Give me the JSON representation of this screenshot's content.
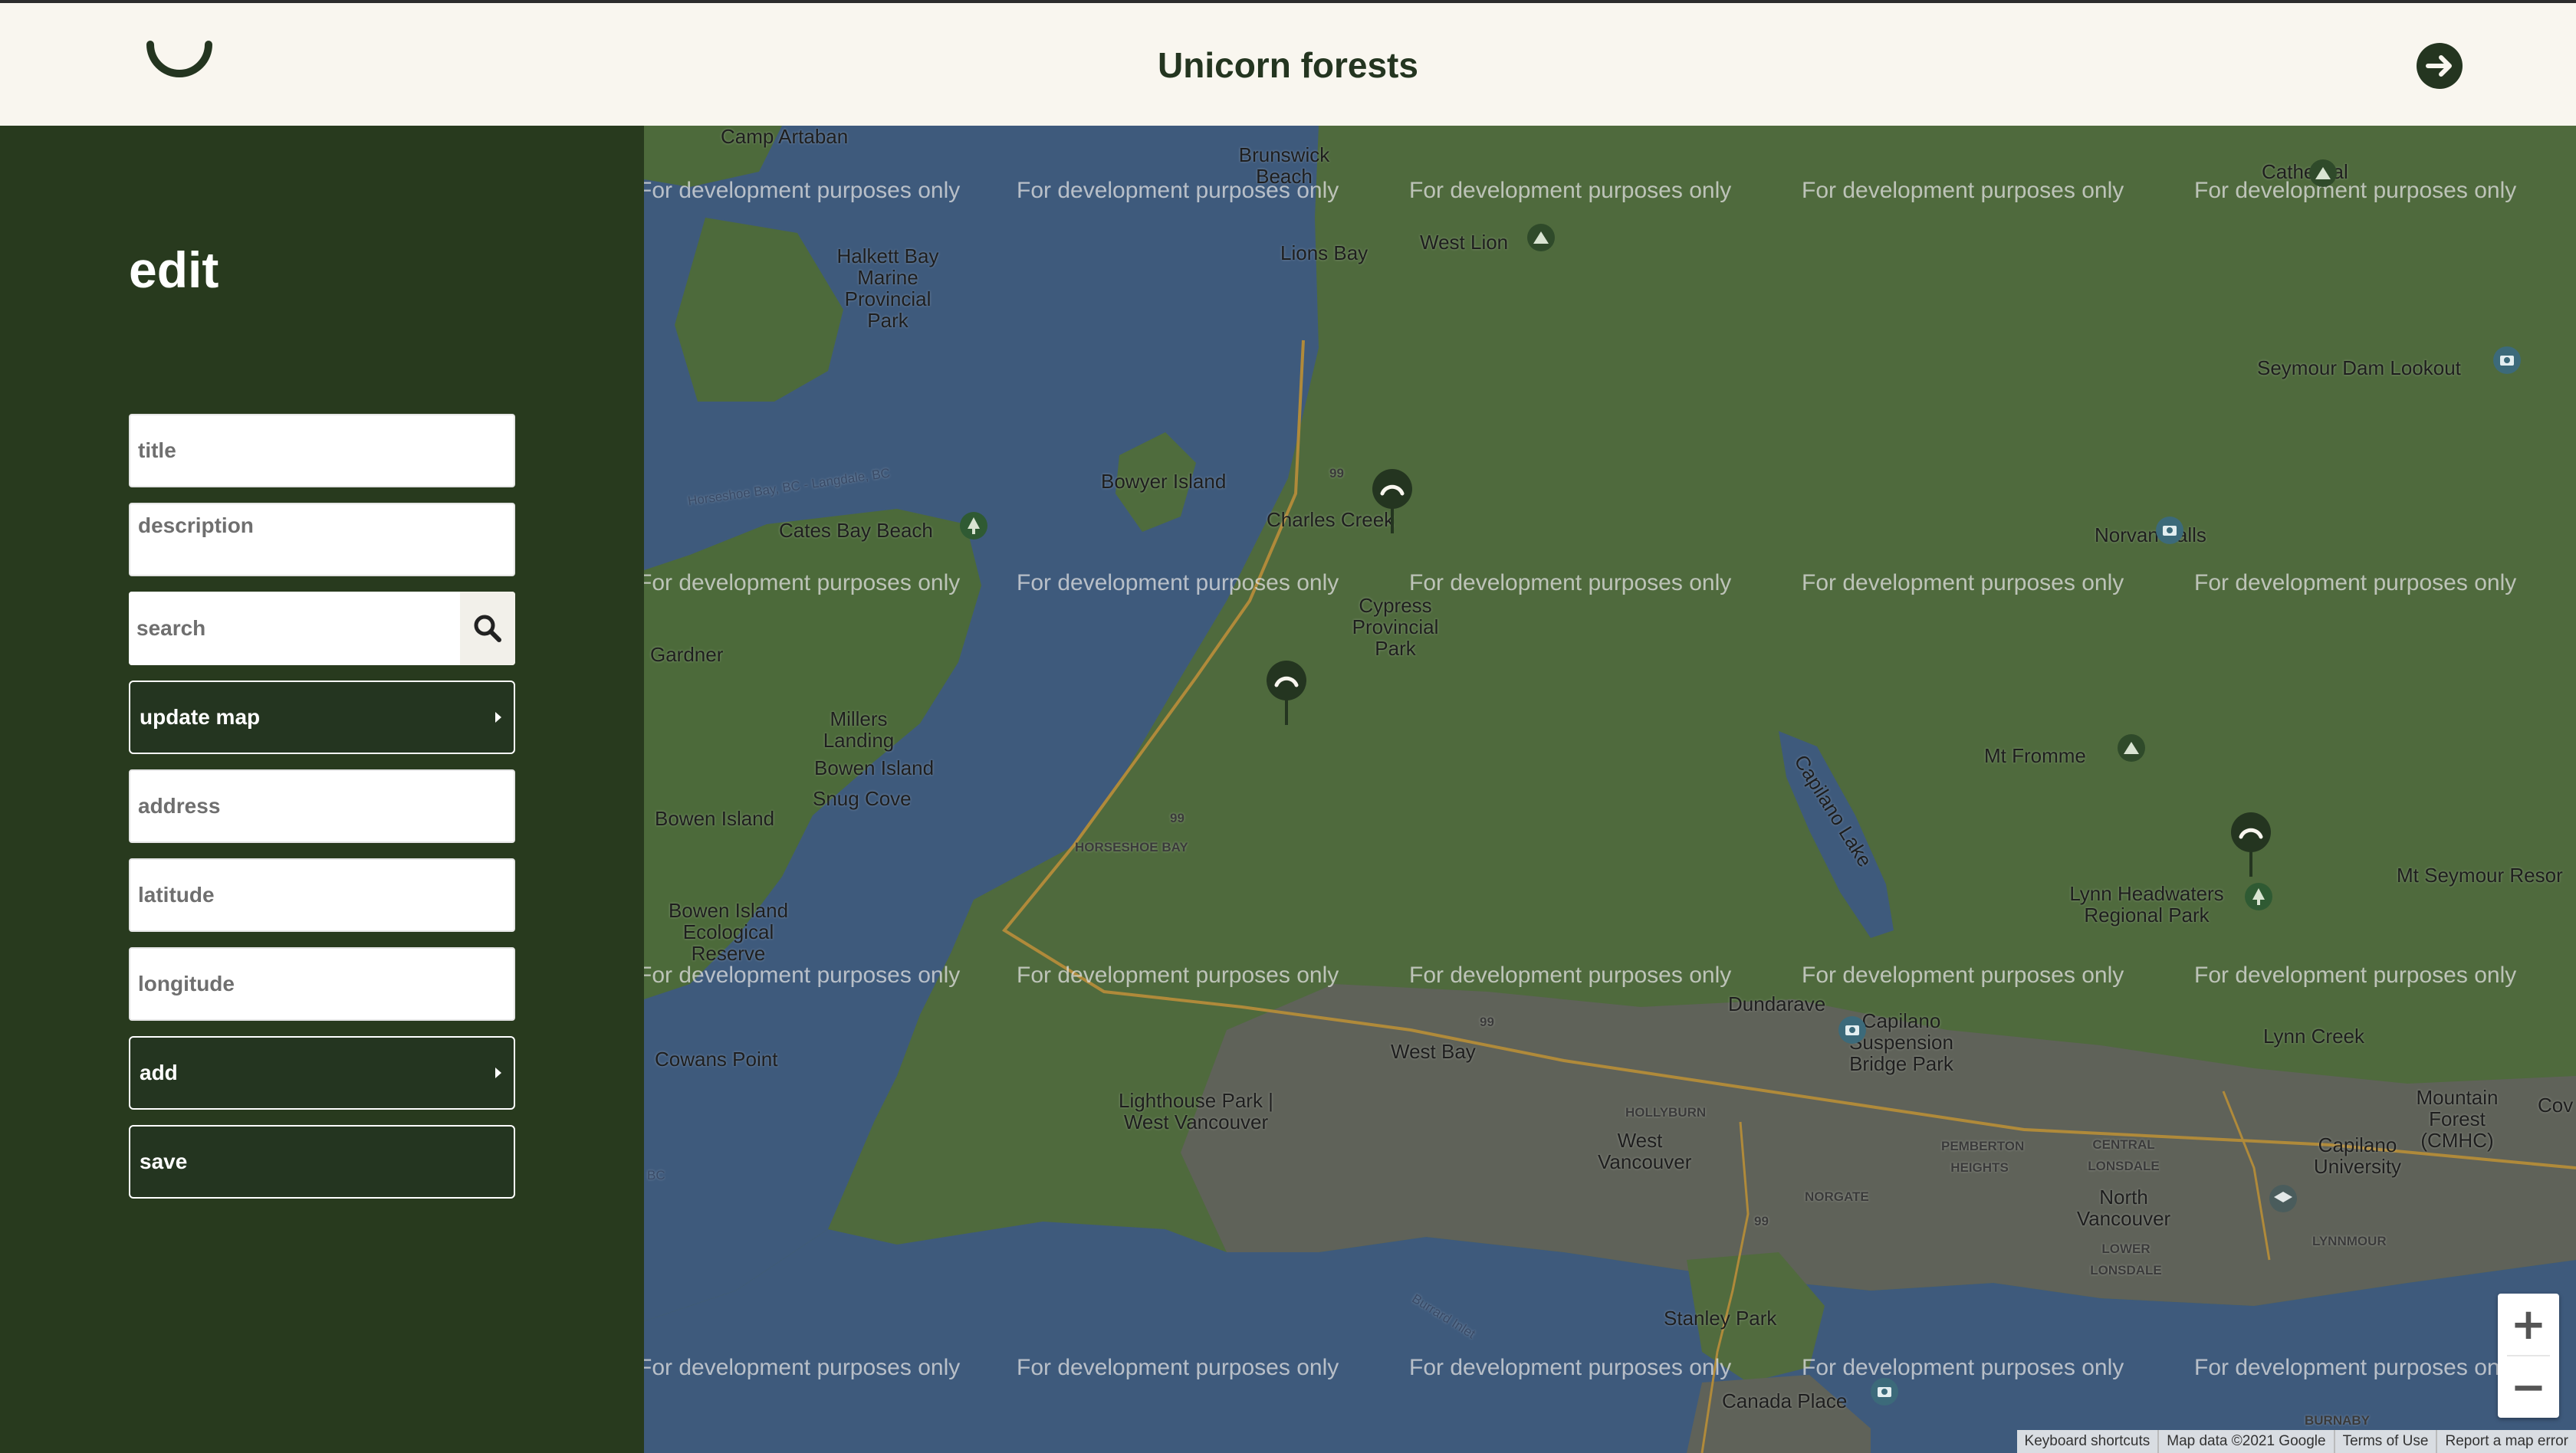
{
  "header": {
    "title": "Unicorn forests",
    "logo_icon": "unicorn-logo",
    "next_icon": "arrow-right-circle-icon"
  },
  "sidebar": {
    "heading": "edit",
    "title_placeholder": "title",
    "description_placeholder": "description",
    "search_placeholder": "search",
    "update_map_label": "update map",
    "address_placeholder": "address",
    "latitude_placeholder": "latitude",
    "longitude_placeholder": "longitude",
    "add_label": "add",
    "save_label": "save"
  },
  "map": {
    "watermark": "For development purposes only",
    "places": {
      "camp_artaban": "Camp Artaban",
      "brunswick_beach": "Brunswick Beach",
      "lions_bay": "Lions Bay",
      "west_lion": "West Lion",
      "cathedral": "Cathedral",
      "halkett_bay": "Halkett Bay Marine Provincial Park",
      "seymour_dam": "Seymour Dam Lookout",
      "bowyer_island": "Bowyer Island",
      "cates_bay_beach": "Cates Bay Beach",
      "charles_creek": "Charles Creek",
      "norvan_falls": "Norvan Falls",
      "horseshoe_route": "Horseshoe Bay, BC - Langdale, BC",
      "cypress": "Cypress Provincial Park",
      "gardner": "Gardner",
      "millers_landing": "Millers Landing",
      "bowen_island": "Bowen Island",
      "snug_cove": "Snug Cove",
      "bowen_island_2": "Bowen Island",
      "horseshoe_bay": "HORSESHOE BAY",
      "mt_fromme": "Mt Fromme",
      "capilano_lake": "Capilano Lake",
      "mt_seymour": "Mt Seymour Resor",
      "lynn_headwaters": "Lynn Headwaters Regional Park",
      "bowen_ecological": "Bowen Island Ecological Reserve",
      "dundarave": "Dundarave",
      "capilano_suspension": "Capilano Suspension Bridge Park",
      "lynn_creek": "Lynn Creek",
      "cowans_point": "Cowans Point",
      "west_bay": "West Bay",
      "lighthouse_park": "Lighthouse Park | West Vancouver",
      "hollyburn": "HOLLYBURN",
      "west_vancouver": "West Vancouver",
      "pemberton_heights": "PEMBERTON HEIGHTS",
      "central_lonsdale": "CENTRAL LONSDALE",
      "mountain_forest": "Mountain Forest (CMHC)",
      "norgate": "NORGATE",
      "north_vancouver": "North Vancouver",
      "lower_lonsdale": "LOWER LONSDALE",
      "capilano_university": "Capilano University",
      "lynnmour": "LYNNMOUR",
      "burrard_inlet": "Burrard Inlet",
      "stanley_park": "Stanley Park",
      "canada_place": "Canada Place",
      "burnaby": "BURNABY",
      "cov": "Cov",
      "bc": "BC",
      "route_99": "99"
    },
    "zoom_in": "+",
    "zoom_out": "−",
    "footer": {
      "shortcuts": "Keyboard shortcuts",
      "map_data": "Map data ©2021 Google",
      "terms": "Terms of Use",
      "report": "Report a map error"
    },
    "colors": {
      "water": "#3e5a7c",
      "land": "#4f6a3d",
      "urban": "#5f6259",
      "sidebar": "#283a1e"
    }
  }
}
